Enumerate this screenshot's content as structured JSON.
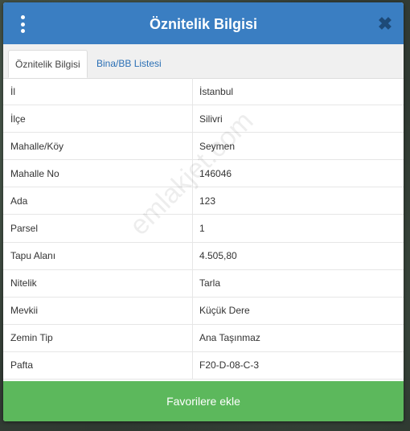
{
  "header": {
    "title": "Öznitelik Bilgisi",
    "close_glyph": "✖"
  },
  "tabs": [
    {
      "label": "Öznitelik Bilgisi",
      "active": true
    },
    {
      "label": "Bina/BB Listesi",
      "active": false
    }
  ],
  "attributes": [
    {
      "key": "İl",
      "value": "İstanbul"
    },
    {
      "key": "İlçe",
      "value": "Silivri"
    },
    {
      "key": "Mahalle/Köy",
      "value": "Seymen"
    },
    {
      "key": "Mahalle No",
      "value": "146046"
    },
    {
      "key": "Ada",
      "value": "123"
    },
    {
      "key": "Parsel",
      "value": "1"
    },
    {
      "key": "Tapu Alanı",
      "value": "4.505,80"
    },
    {
      "key": "Nitelik",
      "value": "Tarla"
    },
    {
      "key": "Mevkii",
      "value": "Küçük Dere"
    },
    {
      "key": "Zemin Tip",
      "value": "Ana Taşınmaz"
    },
    {
      "key": "Pafta",
      "value": "F20-D-08-C-3"
    }
  ],
  "footer": {
    "favorite_label": "Favorilere ekle"
  },
  "watermark": "emlakjet.com",
  "colors": {
    "header_bg": "#3a7ec2",
    "button_bg": "#5cb85c",
    "tab_link": "#2a6fb5"
  },
  "icons": {
    "menu": "kebab-menu-icon",
    "close": "close-icon"
  }
}
